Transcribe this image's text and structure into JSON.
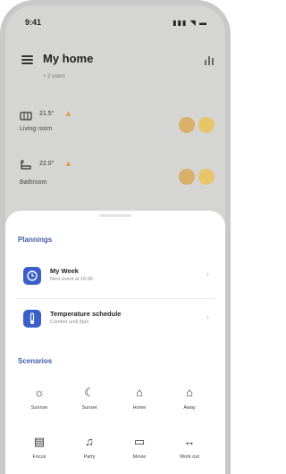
{
  "status_bar": {
    "time": "9:41",
    "indicators": "▮▮▮ ◥ ▬"
  },
  "header": {
    "title": "My home",
    "subtitle": "+ 2 users"
  },
  "rooms": [
    {
      "name": "Living room",
      "temperature": "21.5°",
      "icon": "radiator-icon"
    },
    {
      "name": "Bathroom",
      "temperature": "22.0°",
      "icon": "bathtub-icon"
    }
  ],
  "plannings": {
    "title": "Plannings",
    "items": [
      {
        "title": "My Week",
        "subtitle": "Next event at 15:00",
        "icon": "clock-icon"
      },
      {
        "title": "Temperature schedule",
        "subtitle": "Comfort until 5pm",
        "icon": "thermometer-icon"
      }
    ]
  },
  "scenarios": {
    "title": "Scenarios",
    "items": [
      {
        "label": "Sunrise",
        "icon": "sun-icon",
        "glyph": "☼"
      },
      {
        "label": "Sunset",
        "icon": "moon-icon",
        "glyph": "☾"
      },
      {
        "label": "Home",
        "icon": "home-icon",
        "glyph": "⌂"
      },
      {
        "label": "Away",
        "icon": "away-icon",
        "glyph": "⌂"
      },
      {
        "label": "Focus",
        "icon": "focus-icon",
        "glyph": "▤"
      },
      {
        "label": "Party",
        "icon": "party-icon",
        "glyph": "♫"
      },
      {
        "label": "Movie",
        "icon": "tv-icon",
        "glyph": "▭"
      },
      {
        "label": "Work out",
        "icon": "dumbbell-icon",
        "glyph": "↔"
      }
    ]
  },
  "colors": {
    "accent": "#3a5fcb",
    "flame": "#e99a36",
    "button_on": "#e9c56a",
    "button_off": "#d9b06a"
  }
}
